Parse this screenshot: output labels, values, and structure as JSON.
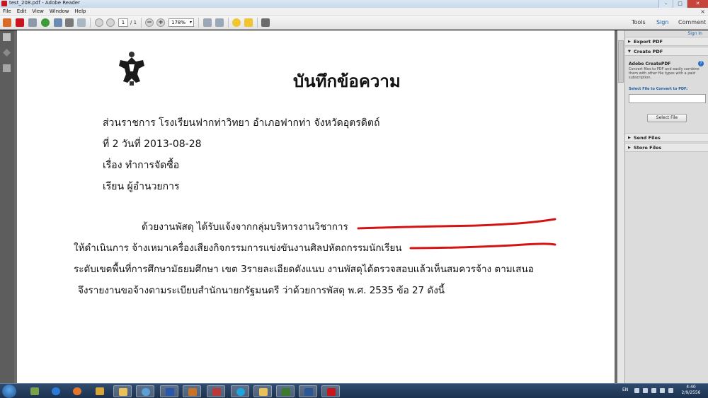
{
  "window": {
    "title": "test_208.pdf - Adobe Reader",
    "minimize": "–",
    "maximize": "□",
    "close": "✕"
  },
  "menubar": {
    "items": [
      "File",
      "Edit",
      "View",
      "Window",
      "Help"
    ],
    "close_glyph": "×"
  },
  "toolbar": {
    "page_current": "1",
    "page_total": "/ 1",
    "zoom_out": "−",
    "zoom_in": "+",
    "zoom_value": "178%",
    "zoom_arrow": "▾",
    "tools_label": "Tools",
    "sign_label": "Sign",
    "comment_label": "Comment"
  },
  "document": {
    "heading": "บันทึกข้อความ",
    "line_agency": "ส่วนราชการ  โรงเรียนฟากท่าวิทยา  อำเภอฟากท่า  จังหวัดอุตรดิตถ์",
    "line_number": "ที่ 2     วันที่ 2013-08-28",
    "line_subject": "เรื่อง ทำการจัดซื้อ",
    "line_to": "เรียน ผู้อำนวยการ",
    "body_line1": "ด้วยงานพัสดุ ได้รับแจ้งจากกลุ่มบริหารงานวิชาการ",
    "body_line2": "ให้ดำเนินการ จ้างเหมาเครื่องเสียงกิจกรรมการแข่งขันงานศิลปหัตถกรรมนักเรียน",
    "body_line3": "ระดับเขตพื้นที่การศึกษามัธยมศึกษา เขต 3รายละเอียดดังแนบ   งานพัสดุได้ตรวจสอบแล้วเห็นสมควรจ้าง ตามเสนอ",
    "body_line4": "จึงรายงานขอจ้างตามระเบียบสำนักนายกรัฐมนตรี ว่าด้วยการพัสดุ  พ.ศ. 2535 ข้อ 27 ดังนี้",
    "annotation_color": "#d41414"
  },
  "right_panel": {
    "sign_in": "Sign In",
    "export_pdf": "Export PDF",
    "create_pdf": "Create PDF",
    "createpdf_title": "Adobe CreatePDF",
    "createpdf_desc": "Convert files to PDF and easily combine them with other file types with a paid subscription.",
    "select_label": "Select File to Convert to PDF:",
    "select_button": "Select File",
    "send_files": "Send Files",
    "store_files": "Store Files",
    "help_glyph": "?",
    "collapsed_glyph": "▶",
    "expanded_glyph": "▼"
  },
  "taskbar": {
    "language": "EN",
    "time": "4:40",
    "date": "2/9/2556"
  }
}
